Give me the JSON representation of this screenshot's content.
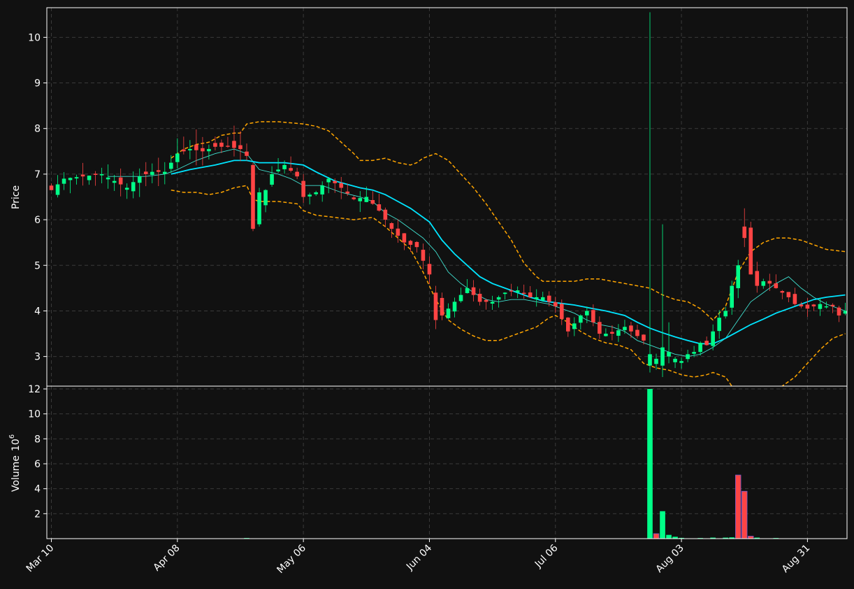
{
  "chart_data": {
    "type": "candlestick",
    "theme": {
      "background": "#111111",
      "grid": "#3a3a3a",
      "axis": "#ffffff",
      "up": "#00ff88",
      "down": "#ff4444",
      "band": "#ffa500",
      "ma_fast": "#40e0d0",
      "ma_slow": "#00e5ff"
    },
    "grid": true,
    "price_panel": {
      "ylabel": "Price",
      "ylim": [
        2.35,
        10.65
      ],
      "yticks": [
        3,
        4,
        5,
        6,
        7,
        8,
        9,
        10
      ],
      "yticklabels": [
        "3",
        "4",
        "5",
        "6",
        "7",
        "8",
        "9",
        "10"
      ]
    },
    "volume_panel": {
      "ylabel": "Volume",
      "scale_label": "10",
      "scale_exponent": "6",
      "ylim": [
        0,
        12
      ],
      "yticks": [
        2,
        4,
        6,
        8,
        10,
        12
      ],
      "yticklabels": [
        "2",
        "4",
        "6",
        "8",
        "10",
        "12"
      ]
    },
    "x_ticks": [
      {
        "index": 0,
        "label": "Mar 10"
      },
      {
        "index": 20,
        "label": "Apr 08"
      },
      {
        "index": 40,
        "label": "May 06"
      },
      {
        "index": 60,
        "label": "Jun 04"
      },
      {
        "index": 80,
        "label": "Jul 06"
      },
      {
        "index": 100,
        "label": "Aug 03"
      },
      {
        "index": 120,
        "label": "Aug 31"
      }
    ],
    "x_count": 127,
    "price_keypoints": [
      [
        0,
        6.65
      ],
      [
        2,
        6.9
      ],
      [
        5,
        6.95
      ],
      [
        8,
        7.0
      ],
      [
        10,
        6.85
      ],
      [
        12,
        6.7
      ],
      [
        14,
        6.95
      ],
      [
        16,
        7.05
      ],
      [
        18,
        7.05
      ],
      [
        20,
        7.45
      ],
      [
        22,
        7.55
      ],
      [
        24,
        7.5
      ],
      [
        26,
        7.6
      ],
      [
        28,
        7.6
      ],
      [
        30,
        7.55
      ],
      [
        31,
        7.4
      ],
      [
        32,
        5.9
      ],
      [
        33,
        6.3
      ],
      [
        35,
        7.0
      ],
      [
        37,
        7.2
      ],
      [
        39,
        6.95
      ],
      [
        40,
        6.5
      ],
      [
        42,
        6.6
      ],
      [
        44,
        6.9
      ],
      [
        46,
        6.7
      ],
      [
        48,
        6.45
      ],
      [
        50,
        6.5
      ],
      [
        52,
        6.2
      ],
      [
        54,
        5.8
      ],
      [
        56,
        5.5
      ],
      [
        58,
        5.4
      ],
      [
        60,
        4.8
      ],
      [
        62,
        3.9
      ],
      [
        64,
        4.2
      ],
      [
        66,
        4.5
      ],
      [
        68,
        4.2
      ],
      [
        70,
        4.2
      ],
      [
        72,
        4.4
      ],
      [
        74,
        4.45
      ],
      [
        76,
        4.3
      ],
      [
        78,
        4.3
      ],
      [
        80,
        4.1
      ],
      [
        82,
        3.55
      ],
      [
        84,
        3.9
      ],
      [
        85,
        4.0
      ],
      [
        87,
        3.5
      ],
      [
        89,
        3.5
      ],
      [
        91,
        3.65
      ],
      [
        94,
        3.35
      ],
      [
        95,
        2.8
      ],
      [
        96,
        2.95
      ],
      [
        97,
        2.8
      ],
      [
        98,
        2.85
      ],
      [
        99,
        2.95
      ],
      [
        100,
        2.9
      ],
      [
        101,
        3.05
      ],
      [
        102,
        3.1
      ],
      [
        103,
        3.3
      ],
      [
        104,
        3.25
      ],
      [
        105,
        3.55
      ],
      [
        106,
        3.85
      ],
      [
        107,
        4.0
      ],
      [
        108,
        4.55
      ],
      [
        109,
        5.0
      ],
      [
        110,
        5.75
      ],
      [
        111,
        4.8
      ],
      [
        112,
        4.55
      ],
      [
        113,
        4.65
      ],
      [
        114,
        4.6
      ],
      [
        115,
        4.5
      ],
      [
        116,
        4.4
      ],
      [
        117,
        4.3
      ],
      [
        118,
        4.15
      ],
      [
        119,
        4.1
      ],
      [
        120,
        4.05
      ],
      [
        121,
        4.1
      ],
      [
        122,
        4.15
      ],
      [
        123,
        4.1
      ],
      [
        124,
        4.1
      ],
      [
        125,
        3.9
      ],
      [
        126,
        4.0
      ]
    ],
    "candle_body_pct": 3.5,
    "candle_wick_pct": 4.5,
    "candle_overrides": [
      {
        "index": 32,
        "open": 7.2,
        "close": 5.8,
        "high": 7.25,
        "low": 5.75
      },
      {
        "index": 33,
        "open": 5.9,
        "close": 6.6,
        "high": 6.7,
        "low": 5.85
      },
      {
        "index": 61,
        "open": 4.4,
        "close": 3.8,
        "high": 4.55,
        "low": 3.6
      },
      {
        "index": 95,
        "open": 2.8,
        "close": 3.05,
        "high": 10.55,
        "low": 2.65
      },
      {
        "index": 97,
        "open": 2.8,
        "close": 3.2,
        "high": 5.9,
        "low": 2.55
      },
      {
        "index": 98,
        "open": 3.0,
        "close": 3.1,
        "high": 3.75,
        "low": 2.85
      },
      {
        "index": 110,
        "open": 5.85,
        "close": 5.6,
        "high": 6.25,
        "low": 5.4
      }
    ],
    "volume_bars": [
      {
        "index": 31,
        "value": 0.05
      },
      {
        "index": 95,
        "value": 12.0,
        "color": "up"
      },
      {
        "index": 96,
        "value": 0.4,
        "color": "down"
      },
      {
        "index": 97,
        "value": 2.2,
        "color": "up"
      },
      {
        "index": 98,
        "value": 0.3,
        "color": "up"
      },
      {
        "index": 99,
        "value": 0.15,
        "color": "up"
      },
      {
        "index": 100,
        "value": 0.06,
        "color": "up"
      },
      {
        "index": 103,
        "value": 0.05,
        "color": "up"
      },
      {
        "index": 105,
        "value": 0.08,
        "color": "up"
      },
      {
        "index": 107,
        "value": 0.08,
        "color": "up"
      },
      {
        "index": 108,
        "value": 0.1,
        "color": "up"
      },
      {
        "index": 109,
        "value": 5.1,
        "color": "down"
      },
      {
        "index": 110,
        "value": 3.8,
        "color": "down"
      },
      {
        "index": 111,
        "value": 0.2,
        "color": "down"
      },
      {
        "index": 112,
        "value": 0.08,
        "color": "up"
      },
      {
        "index": 115,
        "value": 0.05,
        "color": "up"
      }
    ],
    "ma_fast_window": 5,
    "ma_slow_window": 20,
    "bollinger_window": 20,
    "bollinger_std": 2,
    "ma_fast_points": [
      [
        9,
        6.95
      ],
      [
        12,
        6.95
      ],
      [
        15,
        6.95
      ],
      [
        18,
        7.0
      ],
      [
        20,
        7.1
      ],
      [
        23,
        7.3
      ],
      [
        26,
        7.45
      ],
      [
        29,
        7.55
      ],
      [
        31,
        7.45
      ],
      [
        33,
        7.1
      ],
      [
        36,
        7.0
      ],
      [
        38,
        6.9
      ],
      [
        40,
        6.75
      ],
      [
        43,
        6.75
      ],
      [
        46,
        6.6
      ],
      [
        49,
        6.5
      ],
      [
        51,
        6.4
      ],
      [
        53,
        6.15
      ],
      [
        55,
        6.0
      ],
      [
        57,
        5.8
      ],
      [
        59,
        5.6
      ],
      [
        61,
        5.3
      ],
      [
        63,
        4.85
      ],
      [
        65,
        4.6
      ],
      [
        67,
        4.4
      ],
      [
        69,
        4.25
      ],
      [
        71,
        4.2
      ],
      [
        73,
        4.25
      ],
      [
        75,
        4.25
      ],
      [
        77,
        4.2
      ],
      [
        79,
        4.15
      ],
      [
        81,
        4.05
      ],
      [
        83,
        3.95
      ],
      [
        85,
        3.8
      ],
      [
        87,
        3.7
      ],
      [
        89,
        3.65
      ],
      [
        91,
        3.55
      ],
      [
        93,
        3.35
      ],
      [
        95,
        3.25
      ],
      [
        97,
        3.15
      ],
      [
        99,
        3.05
      ],
      [
        101,
        3.0
      ],
      [
        103,
        3.05
      ],
      [
        105,
        3.2
      ],
      [
        107,
        3.4
      ],
      [
        109,
        3.8
      ],
      [
        111,
        4.2
      ],
      [
        113,
        4.4
      ],
      [
        115,
        4.6
      ],
      [
        117,
        4.75
      ],
      [
        119,
        4.5
      ],
      [
        121,
        4.3
      ],
      [
        123,
        4.15
      ],
      [
        126,
        4.0
      ]
    ],
    "ma_slow_points": [
      [
        19,
        7.0
      ],
      [
        22,
        7.1
      ],
      [
        26,
        7.2
      ],
      [
        29,
        7.3
      ],
      [
        31,
        7.3
      ],
      [
        33,
        7.25
      ],
      [
        37,
        7.25
      ],
      [
        40,
        7.2
      ],
      [
        42,
        7.05
      ],
      [
        45,
        6.85
      ],
      [
        49,
        6.7
      ],
      [
        51,
        6.65
      ],
      [
        53,
        6.55
      ],
      [
        55,
        6.4
      ],
      [
        57,
        6.25
      ],
      [
        60,
        5.95
      ],
      [
        62,
        5.55
      ],
      [
        64,
        5.25
      ],
      [
        66,
        5.0
      ],
      [
        68,
        4.75
      ],
      [
        70,
        4.6
      ],
      [
        72,
        4.5
      ],
      [
        74,
        4.4
      ],
      [
        76,
        4.3
      ],
      [
        78,
        4.22
      ],
      [
        80,
        4.18
      ],
      [
        83,
        4.13
      ],
      [
        86,
        4.05
      ],
      [
        88,
        4.0
      ],
      [
        91,
        3.9
      ],
      [
        93,
        3.75
      ],
      [
        95,
        3.62
      ],
      [
        97,
        3.52
      ],
      [
        99,
        3.43
      ],
      [
        101,
        3.35
      ],
      [
        103,
        3.28
      ],
      [
        105,
        3.28
      ],
      [
        107,
        3.4
      ],
      [
        109,
        3.55
      ],
      [
        111,
        3.7
      ],
      [
        113,
        3.82
      ],
      [
        115,
        3.95
      ],
      [
        117,
        4.05
      ],
      [
        119,
        4.15
      ],
      [
        121,
        4.25
      ],
      [
        123,
        4.3
      ],
      [
        126,
        4.35
      ]
    ],
    "bollinger_upper": [
      [
        19,
        7.35
      ],
      [
        21,
        7.55
      ],
      [
        23,
        7.65
      ],
      [
        25,
        7.7
      ],
      [
        27,
        7.85
      ],
      [
        29,
        7.9
      ],
      [
        30,
        7.9
      ],
      [
        31,
        8.1
      ],
      [
        33,
        8.15
      ],
      [
        36,
        8.15
      ],
      [
        40,
        8.1
      ],
      [
        42,
        8.05
      ],
      [
        44,
        7.95
      ],
      [
        46,
        7.7
      ],
      [
        48,
        7.45
      ],
      [
        49,
        7.3
      ],
      [
        51,
        7.3
      ],
      [
        53,
        7.35
      ],
      [
        55,
        7.25
      ],
      [
        57,
        7.2
      ],
      [
        58,
        7.25
      ],
      [
        59,
        7.35
      ],
      [
        61,
        7.45
      ],
      [
        63,
        7.3
      ],
      [
        65,
        7.0
      ],
      [
        67,
        6.7
      ],
      [
        69,
        6.35
      ],
      [
        71,
        5.95
      ],
      [
        73,
        5.55
      ],
      [
        74,
        5.3
      ],
      [
        75,
        5.05
      ],
      [
        77,
        4.75
      ],
      [
        78,
        4.65
      ],
      [
        80,
        4.65
      ],
      [
        83,
        4.65
      ],
      [
        85,
        4.7
      ],
      [
        87,
        4.7
      ],
      [
        89,
        4.65
      ],
      [
        91,
        4.6
      ],
      [
        93,
        4.55
      ],
      [
        95,
        4.5
      ],
      [
        97,
        4.35
      ],
      [
        99,
        4.25
      ],
      [
        101,
        4.2
      ],
      [
        103,
        4.05
      ],
      [
        105,
        3.8
      ],
      [
        107,
        4.1
      ],
      [
        109,
        4.85
      ],
      [
        111,
        5.3
      ],
      [
        113,
        5.5
      ],
      [
        115,
        5.6
      ],
      [
        117,
        5.6
      ],
      [
        119,
        5.55
      ],
      [
        121,
        5.45
      ],
      [
        123,
        5.35
      ],
      [
        126,
        5.3
      ]
    ],
    "bollinger_lower": [
      [
        19,
        6.65
      ],
      [
        21,
        6.6
      ],
      [
        23,
        6.6
      ],
      [
        25,
        6.55
      ],
      [
        27,
        6.6
      ],
      [
        29,
        6.7
      ],
      [
        31,
        6.75
      ],
      [
        32,
        6.45
      ],
      [
        33,
        6.4
      ],
      [
        36,
        6.4
      ],
      [
        39,
        6.35
      ],
      [
        40,
        6.2
      ],
      [
        42,
        6.1
      ],
      [
        45,
        6.05
      ],
      [
        48,
        6.0
      ],
      [
        51,
        6.05
      ],
      [
        53,
        5.85
      ],
      [
        55,
        5.6
      ],
      [
        57,
        5.35
      ],
      [
        59,
        4.85
      ],
      [
        61,
        4.25
      ],
      [
        63,
        3.8
      ],
      [
        65,
        3.6
      ],
      [
        67,
        3.45
      ],
      [
        69,
        3.35
      ],
      [
        71,
        3.35
      ],
      [
        73,
        3.45
      ],
      [
        75,
        3.55
      ],
      [
        77,
        3.65
      ],
      [
        79,
        3.85
      ],
      [
        80,
        3.9
      ],
      [
        82,
        3.75
      ],
      [
        84,
        3.55
      ],
      [
        86,
        3.4
      ],
      [
        88,
        3.3
      ],
      [
        90,
        3.25
      ],
      [
        92,
        3.15
      ],
      [
        94,
        2.85
      ],
      [
        96,
        2.75
      ],
      [
        98,
        2.7
      ],
      [
        100,
        2.6
      ],
      [
        102,
        2.55
      ],
      [
        104,
        2.6
      ],
      [
        105,
        2.65
      ],
      [
        107,
        2.55
      ],
      [
        108,
        2.35
      ],
      [
        110,
        2.2
      ],
      [
        113,
        2.2
      ],
      [
        116,
        2.35
      ],
      [
        118,
        2.55
      ],
      [
        120,
        2.85
      ],
      [
        122,
        3.15
      ],
      [
        124,
        3.4
      ],
      [
        126,
        3.5
      ]
    ]
  }
}
